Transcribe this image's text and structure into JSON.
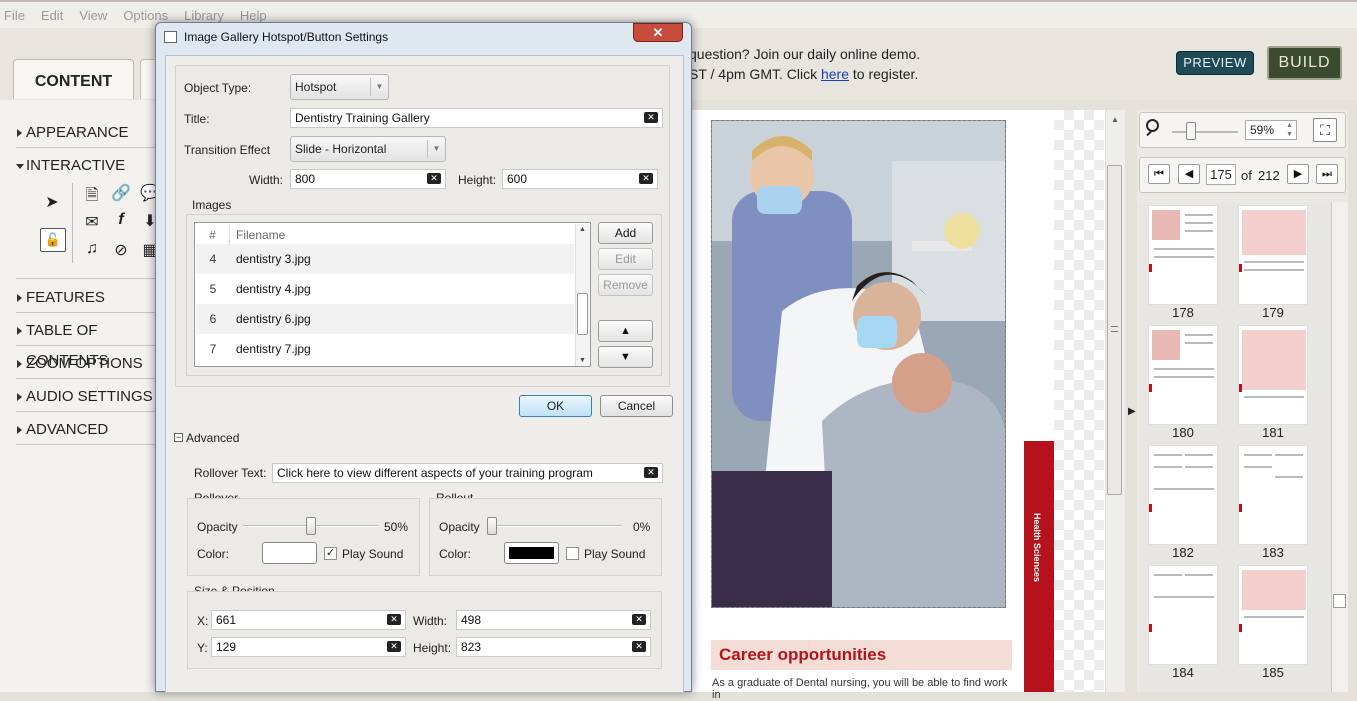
{
  "menu": [
    "File",
    "Edit",
    "View",
    "Options",
    "Library",
    "Help"
  ],
  "tabs": {
    "content": "CONTENT"
  },
  "notice": {
    "line1": "question? Join our daily online demo.",
    "line2a": "ST / 4pm GMT. Click ",
    "link": "here",
    "line2b": " to register."
  },
  "buttons": {
    "preview": "PREVIEW",
    "build": "BUILD"
  },
  "left": {
    "sections": [
      "APPEARANCE",
      "INTERACTIVE",
      "FEATURES",
      "TABLE OF CONTENTS",
      "ZOOM OPTIONS",
      "AUDIO SETTINGS",
      "ADVANCED"
    ]
  },
  "dialog": {
    "title": "Image Gallery Hotspot/Button Settings",
    "close": "✕",
    "object_type_label": "Object Type:",
    "object_type": "Hotspot",
    "title_label": "Title:",
    "title_value": "Dentistry Training Gallery",
    "transition_label": "Transition Effect",
    "transition": "Slide - Horizontal",
    "width_label": "Width:",
    "width": "800",
    "height_label": "Height:",
    "height": "600",
    "images_label": "Images",
    "col_num": "#",
    "col_file": "Filename",
    "rows": [
      {
        "n": "4",
        "f": "dentistry 3.jpg"
      },
      {
        "n": "5",
        "f": "dentistry 4.jpg"
      },
      {
        "n": "6",
        "f": "dentistry 6.jpg"
      },
      {
        "n": "7",
        "f": "dentistry 7.jpg"
      }
    ],
    "add": "Add",
    "edit": "Edit",
    "remove": "Remove",
    "up": "▲",
    "down": "▼",
    "ok": "OK",
    "cancel": "Cancel",
    "advanced": "Advanced",
    "rollover_text_label": "Rollover Text:",
    "rollover_text": "Click here to view different aspects of your training program",
    "rollover": {
      "title": "Rollover",
      "opacity_label": "Opacity",
      "opacity": "50%",
      "opacity_value": 0.5,
      "color_label": "Color:",
      "color": "#ffffff",
      "play_sound": "Play Sound",
      "play_checked": "✓"
    },
    "rollout": {
      "title": "Rollout",
      "opacity_label": "Opacity",
      "opacity": "0%",
      "opacity_value": 0,
      "color_label": "Color:",
      "color": "#000000",
      "play_sound": "Play Sound"
    },
    "size_position": "Size & Position",
    "x_label": "X:",
    "x": "661",
    "y_label": "Y:",
    "y": "129",
    "sw_label": "Width:",
    "sw": "498",
    "sh_label": "Height:",
    "sh": "823"
  },
  "page": {
    "side_band": "Health Sciences",
    "career": "Career opportunities",
    "body": "As a graduate of Dental nursing, you will be able to find work in"
  },
  "zoom": {
    "value": "59%"
  },
  "nav": {
    "current": "175",
    "of": "of",
    "total": "212",
    "first": "⏮",
    "prev": "◀",
    "next": "▶",
    "last": "⏭"
  },
  "thumbs": [
    "178",
    "179",
    "180",
    "181",
    "182",
    "183",
    "184",
    "185"
  ],
  "colors": {
    "accent_red": "#b5121b",
    "preview_bg": "#1f4b57",
    "build_bg": "#3c4a2e"
  }
}
